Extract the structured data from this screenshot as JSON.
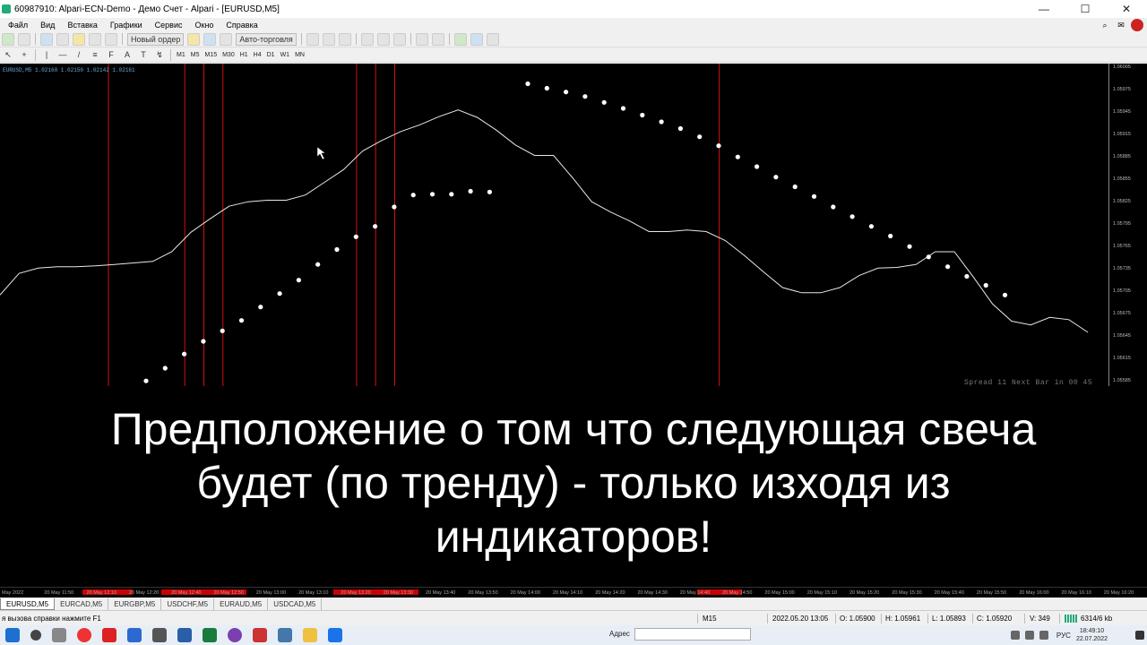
{
  "window": {
    "title": "60987910: Alpari-ECN-Demo - Демо Счет - Alpari - [EURUSD,M5]",
    "controls": [
      "—",
      "☐",
      "✕"
    ]
  },
  "menu": [
    "Файл",
    "Вид",
    "Вставка",
    "Графики",
    "Сервис",
    "Окно",
    "Справка"
  ],
  "toolbar": {
    "new_order_label": "Новый ордер",
    "autotrade_label": "Авто-торговля",
    "timeframes": [
      "M1",
      "M5",
      "M15",
      "M30",
      "H1",
      "H4",
      "D1",
      "W1",
      "MN"
    ]
  },
  "chart": {
    "header": "EURUSD,M5  1.02160 1.02150 1.02142 1.02161",
    "spread_text": "Spread  11  Next Bar in 00 45",
    "price_ticks": [
      "1.06005",
      "1.05975",
      "1.05945",
      "1.05915",
      "1.05885",
      "1.05855",
      "1.05825",
      "1.05795",
      "1.05765",
      "1.05735",
      "1.05705",
      "1.05675",
      "1.05645",
      "1.05615",
      "1.05585"
    ],
    "line_color": "#e8e8e8",
    "dot_color": "#ffffff",
    "vline_color": "#d01010",
    "price_line": [
      1.057,
      1.05729,
      1.05736,
      1.05738,
      1.05738,
      1.05739,
      1.05741,
      1.05743,
      1.05745,
      1.05758,
      1.05784,
      1.05802,
      1.05819,
      1.05825,
      1.05827,
      1.05827,
      1.05834,
      1.05851,
      1.05868,
      1.05893,
      1.05907,
      1.05919,
      1.05928,
      1.05939,
      1.05948,
      1.05938,
      1.05921,
      1.05901,
      1.05887,
      1.05887,
      1.05857,
      1.05825,
      1.05811,
      1.05799,
      1.05785,
      1.05785,
      1.05787,
      1.05785,
      1.05773,
      1.05753,
      1.05731,
      1.0571,
      1.05703,
      1.05703,
      1.0571,
      1.05726,
      1.05736,
      1.05737,
      1.05741,
      1.05758,
      1.05758,
      1.05724,
      1.05688,
      1.05665,
      1.0566,
      1.0567,
      1.05667,
      1.0565
    ],
    "sar_dots": [
      1.05585,
      1.05602,
      1.05621,
      1.05638,
      1.05652,
      1.05666,
      1.05684,
      1.05702,
      1.0572,
      1.05741,
      1.05761,
      1.05778,
      1.05792,
      1.05818,
      1.05834,
      1.05835,
      1.05835,
      1.05839,
      1.05838,
      null,
      1.05983,
      1.05977,
      1.05972,
      1.05966,
      1.05958,
      1.0595,
      1.05941,
      1.05932,
      1.05923,
      1.05912,
      1.059,
      1.05885,
      1.05872,
      1.05858,
      1.05845,
      1.05832,
      1.05818,
      1.05805,
      1.05792,
      1.05779,
      1.05765,
      1.05751,
      1.05738,
      1.05725,
      1.05713,
      1.057
    ],
    "vlines_bars": [
      6,
      10,
      11,
      12,
      19,
      20,
      21,
      38
    ],
    "price_min": 1.05578,
    "price_max": 1.0601
  },
  "caption": {
    "line1": "Предположение о том что следующая свеча",
    "line2": "будет (по тренду) - только изходя из",
    "line3": "индикаторов!"
  },
  "time_axis": [
    "May 2022",
    "20 May 11:50",
    "20 May 12:10",
    "20 May 12:20",
    "20 May 12:40",
    "20 May 12:50",
    "20 May 13:00",
    "20 May 13:10",
    "20 May 13:20",
    "20 May 13:30",
    "20 May 13:40",
    "20 May 13:50",
    "20 May 14:00",
    "20 May 14:10",
    "20 May 14:20",
    "20 May 14:30",
    "20 May 14:40",
    "20 May 14:50",
    "20 May 15:00",
    "20 May 15:10",
    "20 May 15:20",
    "20 May 15:30",
    "20 May 15:40",
    "20 May 15:50",
    "20 May 16:00",
    "20 May 16:10",
    "20 May 16:20"
  ],
  "tabs": [
    "EURUSD,M5",
    "EURCAD,M5",
    "EURGBP,M5",
    "USDCHF,M5",
    "EURAUD,M5",
    "USDCAD,M5"
  ],
  "status": {
    "help": "я вызова справки нажмите F1",
    "timeframe": "M15",
    "datetime": "2022.05.20 13:05",
    "open": "O: 1.05900",
    "high": "H: 1.05961",
    "low": "L: 1.05893",
    "close": "C: 1.05920",
    "volume": "V: 349",
    "traffic": "6314/6 kb"
  },
  "taskbar": {
    "address_label": "Адрес",
    "lang": "РУС",
    "time": "18:49:10",
    "date": "22.07.2022"
  }
}
